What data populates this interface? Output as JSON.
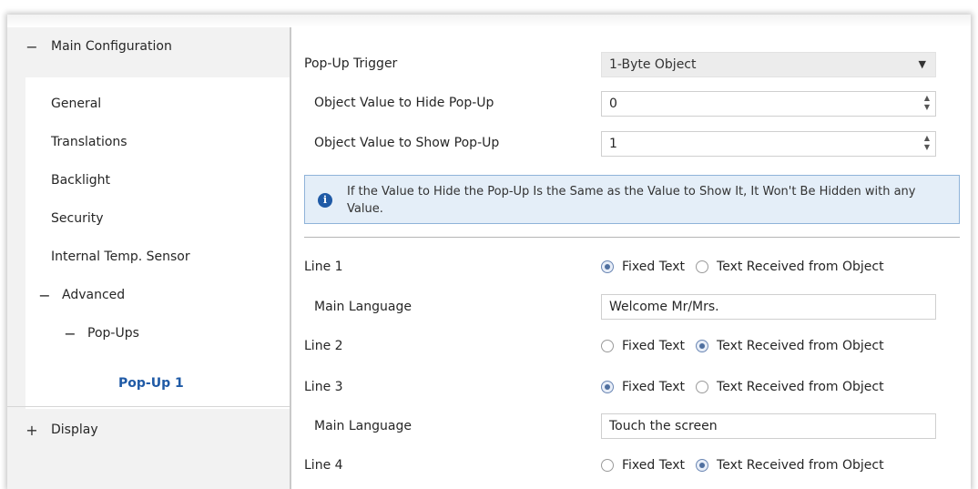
{
  "sidebar": {
    "main_configuration": {
      "toggle": "−",
      "label": "Main Configuration"
    },
    "items": [
      {
        "label": "General"
      },
      {
        "label": "Translations"
      },
      {
        "label": "Backlight"
      },
      {
        "label": "Security"
      },
      {
        "label": "Internal Temp. Sensor"
      }
    ],
    "advanced": {
      "toggle": "−",
      "label": "Advanced"
    },
    "popups": {
      "toggle": "−",
      "label": "Pop-Ups"
    },
    "popup1": {
      "label": "Pop-Up 1"
    },
    "display": {
      "toggle": "+",
      "label": "Display"
    }
  },
  "main": {
    "popup_trigger": {
      "label": "Pop-Up Trigger",
      "value": "1-Byte Object"
    },
    "hide_value": {
      "label": "Object Value to Hide Pop-Up",
      "value": "0"
    },
    "show_value": {
      "label": "Object Value to Show Pop-Up",
      "value": "1"
    },
    "info": {
      "text": "If the Value to Hide the Pop-Up Is the Same as the Value to Show It, It Won't Be Hidden with any Value."
    },
    "radio_labels": {
      "fixed": "Fixed Text",
      "object": "Text Received from Object"
    },
    "lines": [
      {
        "label": "Line 1",
        "selected": "fixed"
      },
      {
        "label": "Line 2",
        "selected": "object"
      },
      {
        "label": "Line 3",
        "selected": "fixed"
      },
      {
        "label": "Line 4",
        "selected": "object"
      }
    ],
    "main_language_label": "Main Language",
    "line1_text": "Welcome Mr/Mrs.",
    "line3_text": "Touch the screen"
  },
  "colors": {
    "accent": "#1f5aa6",
    "info_bg": "#e4eef8",
    "info_border": "#8fb3d9",
    "sidebar_bg": "#f2f2f2"
  }
}
